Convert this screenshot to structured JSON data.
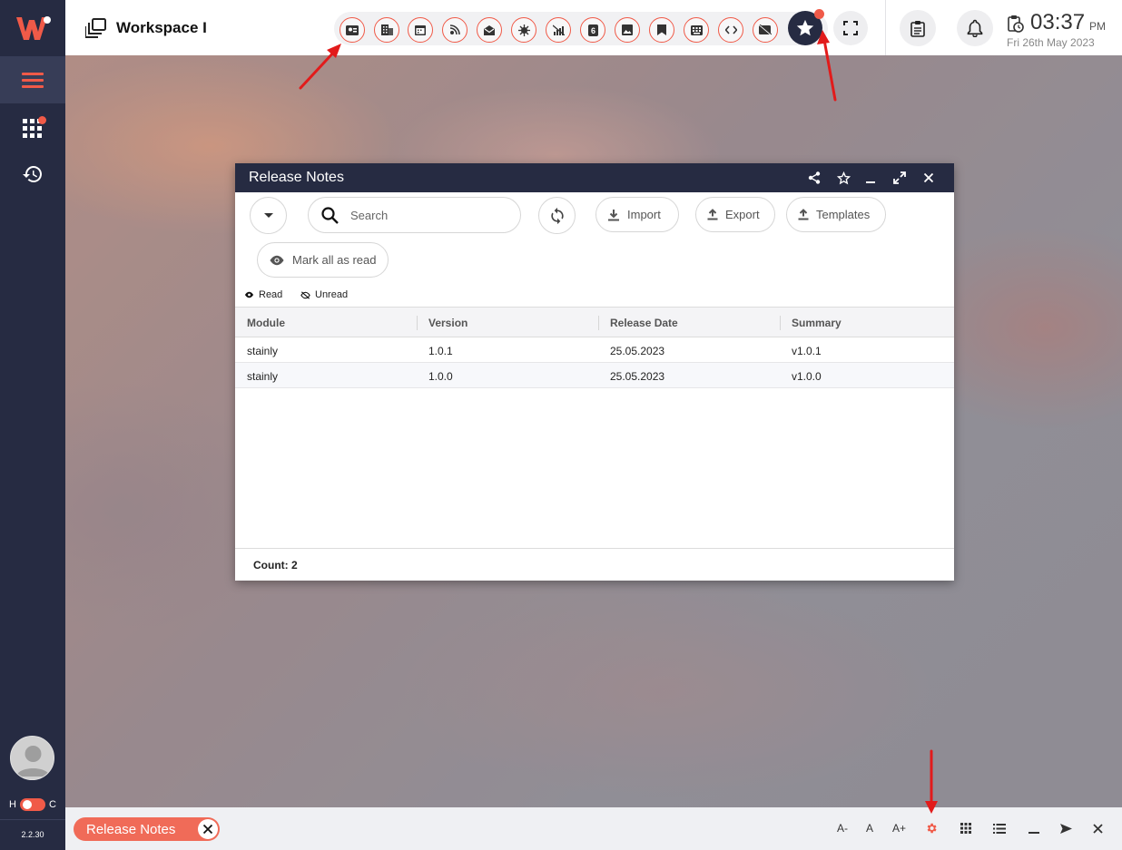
{
  "app": {
    "workspace_title": "Workspace I",
    "version": "2.2.30",
    "toggle_left": "H",
    "toggle_right": "C",
    "brand_color": "#f05a48",
    "sidebar_color": "#262b42"
  },
  "sidebar": {
    "items": [
      {
        "name": "menu-icon",
        "active": true
      },
      {
        "name": "apps-grid-icon",
        "has_badge": true
      },
      {
        "name": "history-icon"
      }
    ]
  },
  "header": {
    "quick_icons": [
      "contact-card-icon",
      "building-icon",
      "calendar-icon",
      "satellite-icon",
      "mail-open-icon",
      "virus-icon",
      "no-signal-icon",
      "number-badge-icon",
      "image-icon",
      "bookmark-icon",
      "keyboard-icon",
      "code-icon",
      "video-off-icon"
    ],
    "favorites_icon": "star-icon",
    "fullscreen_icon": "fullscreen-icon",
    "clipboard_icon": "clipboard-icon",
    "notifications_icon": "bell-icon",
    "clock": {
      "time": "03:37",
      "ampm": "PM",
      "date": "Fri 26th May 2023"
    }
  },
  "window": {
    "title": "Release Notes",
    "title_actions": [
      "share-icon",
      "star-outline-icon",
      "minimize-icon",
      "maximize-icon",
      "close-icon"
    ],
    "toolbar": {
      "search_placeholder": "Search",
      "import_label": "Import",
      "export_label": "Export",
      "templates_label": "Templates",
      "mark_all_read_label": "Mark all as read"
    },
    "legend": {
      "read": "Read",
      "unread": "Unread"
    },
    "grid": {
      "columns": [
        "Module",
        "Version",
        "Release Date",
        "Summary"
      ],
      "rows": [
        [
          "stainly",
          "1.0.1",
          "25.05.2023",
          "v1.0.1"
        ],
        [
          "stainly",
          "1.0.0",
          "25.05.2023",
          "v1.0.0"
        ]
      ],
      "count_label": "Count: 2"
    }
  },
  "bottom_bar": {
    "task_label": "Release Notes",
    "font_smaller": "A-",
    "font_normal": "A",
    "font_larger": "A+"
  }
}
